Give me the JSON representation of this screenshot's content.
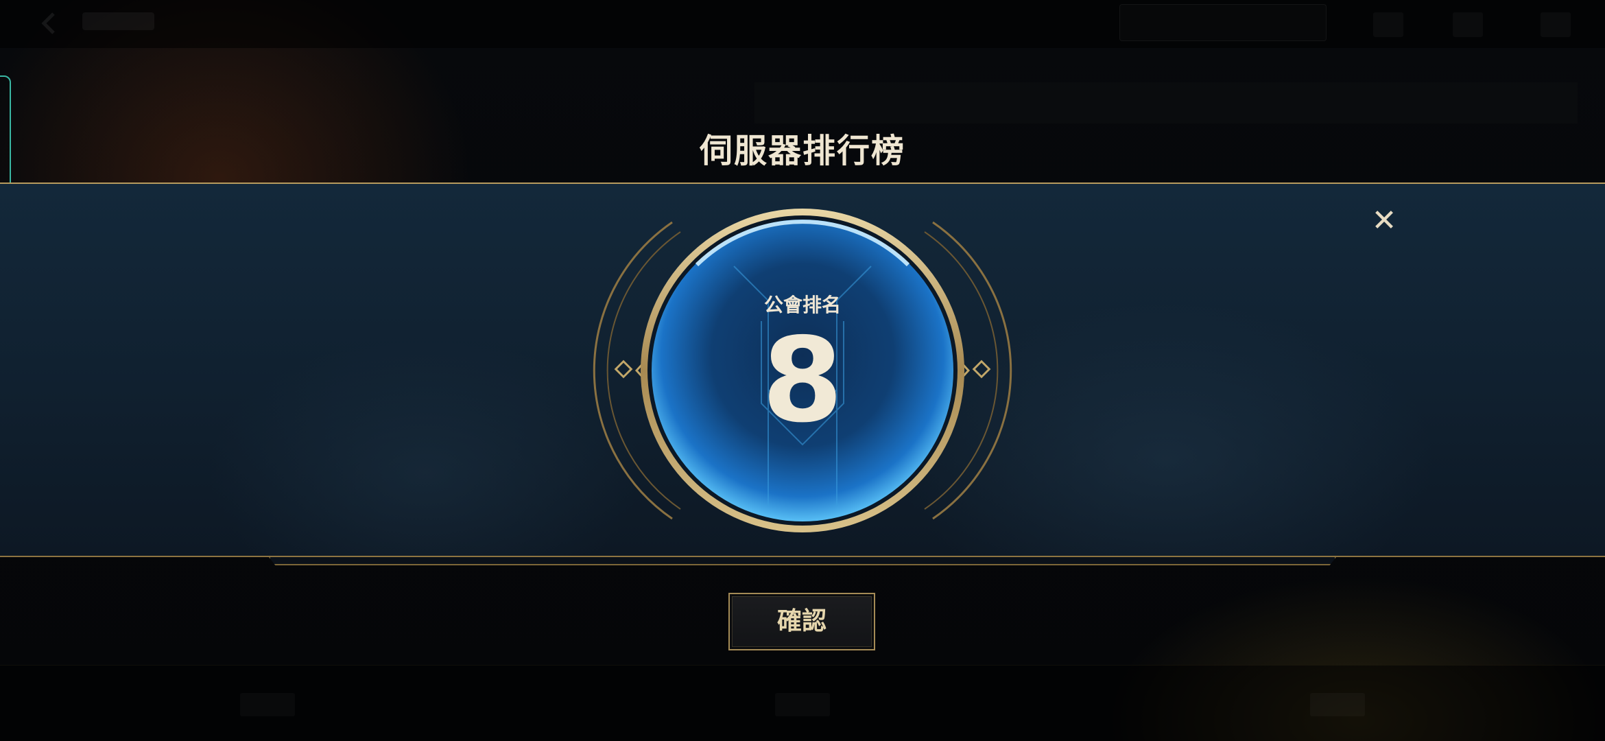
{
  "dialog": {
    "title": "伺服器排行榜",
    "close_glyph": "✕",
    "confirm_label": "確認"
  },
  "emblem": {
    "label": "公會排名",
    "rank": "8"
  },
  "icons": {
    "close": "close-icon",
    "back": "back-arrow-icon"
  },
  "colors": {
    "gold": "#b79b5e",
    "orb_blue": "#1b73c7",
    "text_cream": "#efe6d2",
    "side_frame": "#3ab7a4"
  }
}
